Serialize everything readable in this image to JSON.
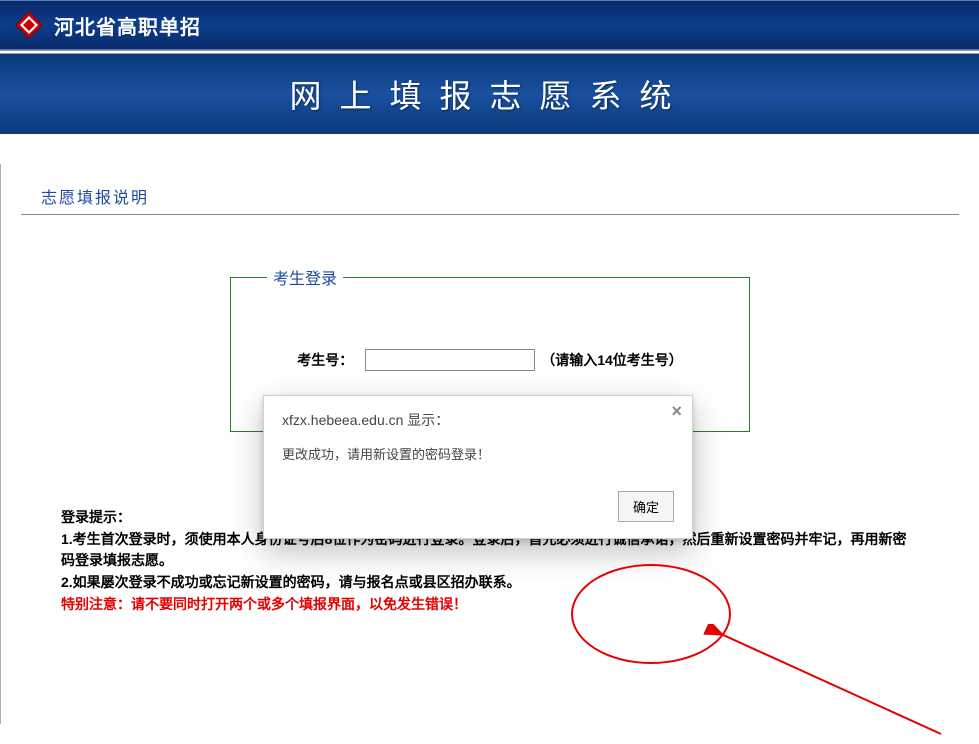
{
  "header": {
    "site_name": "河北省高职单招"
  },
  "banner": {
    "title": "网上填报志愿系统"
  },
  "section": {
    "title": "志愿填报说明"
  },
  "login": {
    "legend": "考生登录",
    "label_examno": "考生号：",
    "examno_value": "",
    "hint_examno": "（请输入14位考生号）"
  },
  "modal": {
    "title": "xfzx.hebeea.edu.cn 显示：",
    "message": "更改成功，请用新设置的密码登录！",
    "ok_label": "确定",
    "close_label": "×"
  },
  "tips": {
    "heading": "登录提示：",
    "line1": "1.考生首次登录时，须使用本人身份证号后8位作为密码进行登录。登录后，首先必须进行诚信承诺，然后重新设置密码并牢记，再用新密码登录填报志愿。",
    "line2": "2.如果屡次登录不成功或忘记新设置的密码，请与报名点或县区招办联系。",
    "warning": "特别注意：请不要同时打开两个或多个填报界面，以免发生错误！"
  }
}
